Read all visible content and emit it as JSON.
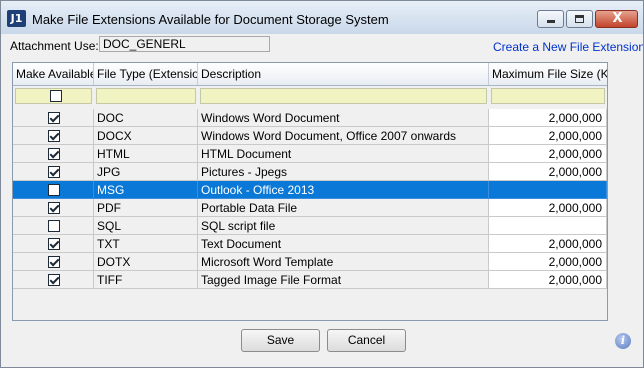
{
  "window": {
    "title": "Make File Extensions Available for Document Storage System",
    "app_icon_text": "J1",
    "close_glyph": "X"
  },
  "attachment": {
    "label": "Attachment Use:",
    "value": "DOC_GENERL"
  },
  "create_link": "Create a New File Extension",
  "grid": {
    "columns": [
      "Make Available",
      "File Type (Extension)",
      "Description",
      "Maximum File Size (KB)"
    ],
    "rows": [
      {
        "available": true,
        "file_type": "DOC",
        "description": "Windows Word Document",
        "max_size": "2,000,000"
      },
      {
        "available": true,
        "file_type": "DOCX",
        "description": "Windows Word Document, Office 2007 onwards",
        "max_size": "2,000,000"
      },
      {
        "available": true,
        "file_type": "HTML",
        "description": "HTML Document",
        "max_size": "2,000,000"
      },
      {
        "available": true,
        "file_type": "JPG",
        "description": "Pictures - Jpegs",
        "max_size": "2,000,000"
      },
      {
        "available": false,
        "file_type": "MSG",
        "description": "Outlook - Office 2013",
        "max_size": "",
        "selected": true
      },
      {
        "available": true,
        "file_type": "PDF",
        "description": "Portable Data File",
        "max_size": "2,000,000"
      },
      {
        "available": false,
        "file_type": "SQL",
        "description": "SQL script file",
        "max_size": ""
      },
      {
        "available": true,
        "file_type": "TXT",
        "description": "Text Document",
        "max_size": "2,000,000"
      },
      {
        "available": true,
        "file_type": "DOTX",
        "description": "Microsoft Word Template",
        "max_size": "2,000,000"
      },
      {
        "available": true,
        "file_type": "TIFF",
        "description": "Tagged Image File Format",
        "max_size": "2,000,000"
      }
    ]
  },
  "buttons": {
    "save": "Save",
    "cancel": "Cancel"
  },
  "info_glyph": "i",
  "colors": {
    "selection": "#0a78d6",
    "filter_row": "#f1f4c2",
    "link": "#0033cc"
  }
}
